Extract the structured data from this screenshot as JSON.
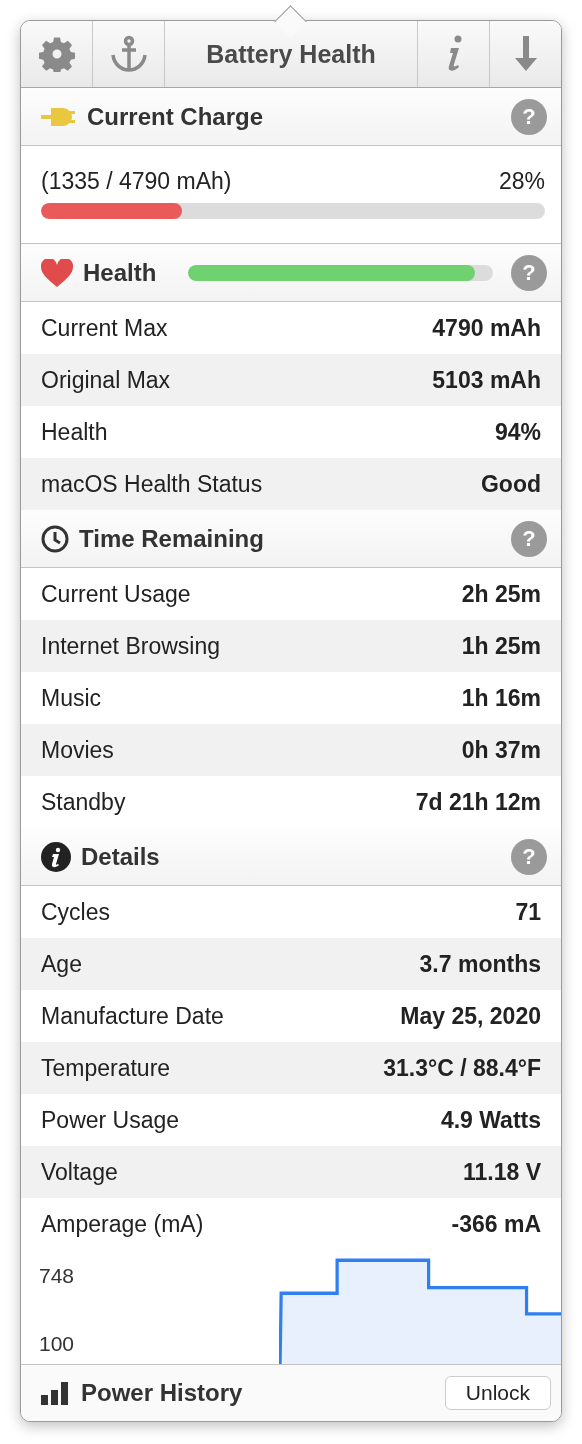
{
  "toolbar": {
    "title": "Battery Health"
  },
  "sections": [
    {
      "kind": "charge",
      "title": "Current Charge",
      "help": "?",
      "reading": "(1335 / 4790 mAh)",
      "percent": "28%",
      "level": 0.28
    },
    {
      "kind": "health",
      "title": "Health",
      "help": "?",
      "level": 0.94,
      "rows": [
        {
          "label": "Current Max",
          "value": "4790 mAh"
        },
        {
          "label": "Original Max",
          "value": "5103 mAh"
        },
        {
          "label": "Health",
          "value": "94%"
        },
        {
          "label": "macOS Health Status",
          "value": "Good"
        }
      ]
    },
    {
      "kind": "time",
      "title": "Time Remaining",
      "help": "?",
      "rows": [
        {
          "label": "Current Usage",
          "value": "2h 25m"
        },
        {
          "label": "Internet Browsing",
          "value": "1h 25m"
        },
        {
          "label": "Music",
          "value": "1h 16m"
        },
        {
          "label": "Movies",
          "value": "0h 37m"
        },
        {
          "label": "Standby",
          "value": "7d 21h 12m"
        }
      ]
    },
    {
      "kind": "details",
      "title": "Details",
      "help": "?",
      "rows": [
        {
          "label": "Cycles",
          "value": "71"
        },
        {
          "label": "Age",
          "value": "3.7 months"
        },
        {
          "label": "Manufacture Date",
          "value": "May 25, 2020"
        },
        {
          "label": "Temperature",
          "value": "31.3°C / 88.4°F"
        },
        {
          "label": "Power Usage",
          "value": "4.9 Watts"
        },
        {
          "label": "Voltage",
          "value": "11.18 V"
        },
        {
          "label": "Amperage (mA)",
          "value": "-366 mA"
        }
      ],
      "graph": {
        "axis_labels": [
          "748",
          "100"
        ]
      }
    }
  ],
  "footer": {
    "title": "Power History",
    "button": "Unlock"
  }
}
